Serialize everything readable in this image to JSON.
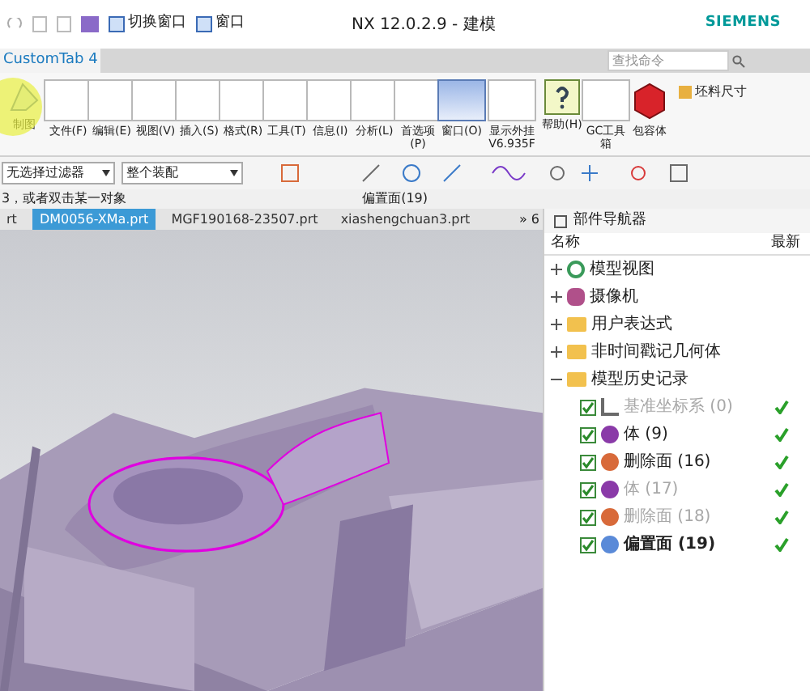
{
  "title_bar": {
    "quick_access": [
      {
        "label": "切换窗口"
      },
      {
        "label": "窗口"
      }
    ],
    "title": "NX 12.0.2.9 - 建模",
    "brand": "SIEMENS"
  },
  "ribbon_tabs": [
    {
      "label": "CustomTab 4",
      "selected": true
    }
  ],
  "search": {
    "placeholder": "查找命令"
  },
  "ribbon_buttons": [
    {
      "label": "制图",
      "kind": "drawing"
    },
    {
      "label": "文件(F)",
      "kind": "menu"
    },
    {
      "label": "编辑(E)",
      "kind": "menu"
    },
    {
      "label": "视图(V)",
      "kind": "menu"
    },
    {
      "label": "插入(S)",
      "kind": "menu"
    },
    {
      "label": "格式(R)",
      "kind": "menu"
    },
    {
      "label": "工具(T)",
      "kind": "menu"
    },
    {
      "label": "信息(I)",
      "kind": "menu"
    },
    {
      "label": "分析(L)",
      "kind": "menu"
    },
    {
      "label": "首选项(P)",
      "kind": "menu"
    },
    {
      "label": "窗口(O)",
      "kind": "window"
    },
    {
      "label": "显示外挂 V6.935F",
      "kind": "menu"
    },
    {
      "label": "帮助(H)",
      "kind": "help"
    },
    {
      "label": "GC工具箱",
      "kind": "menu"
    },
    {
      "label": "包容体",
      "kind": "box"
    }
  ],
  "side_commands": [
    {
      "label": "坯料尺寸",
      "disabled": false
    }
  ],
  "filters": [
    {
      "value": "无选择过滤器"
    },
    {
      "value": "整个装配"
    }
  ],
  "status": {
    "prompt": "3，或者双击某一对象",
    "feature": "偏置面(19)"
  },
  "doc_tabs": [
    {
      "label": "rt",
      "selected": false
    },
    {
      "label": "DM0056-XMa.prt",
      "selected": true
    },
    {
      "label": "MGF190168-23507.prt",
      "selected": false
    },
    {
      "label": "xiashengchuan3.prt",
      "selected": false
    }
  ],
  "doc_tabs_more": "» 6",
  "navigator": {
    "title": "部件导航器",
    "columns": [
      "名称",
      "最新"
    ],
    "tree": [
      {
        "label": "模型视图",
        "expanded": false,
        "kind": "views"
      },
      {
        "label": "摄像机",
        "expanded": false,
        "kind": "camera"
      },
      {
        "label": "用户表达式",
        "expanded": false,
        "kind": "folder"
      },
      {
        "label": "非时间戳记几何体",
        "expanded": false,
        "kind": "folder"
      },
      {
        "label": "模型历史记录",
        "expanded": true,
        "kind": "folder",
        "children": [
          {
            "label": "基准坐标系 (0)",
            "checked": true,
            "suppressed": true,
            "current": false,
            "latest": true,
            "kind": "datum"
          },
          {
            "label": "体 (9)",
            "checked": true,
            "suppressed": false,
            "current": false,
            "latest": true,
            "kind": "body"
          },
          {
            "label": "删除面 (16)",
            "checked": true,
            "suppressed": false,
            "current": false,
            "latest": true,
            "kind": "delete"
          },
          {
            "label": "体 (17)",
            "checked": true,
            "suppressed": true,
            "current": false,
            "latest": true,
            "kind": "body"
          },
          {
            "label": "删除面 (18)",
            "checked": true,
            "suppressed": true,
            "current": false,
            "latest": true,
            "kind": "delete"
          },
          {
            "label": "偏置面 (19)",
            "checked": true,
            "suppressed": false,
            "current": true,
            "latest": true,
            "kind": "offset"
          }
        ]
      }
    ]
  }
}
